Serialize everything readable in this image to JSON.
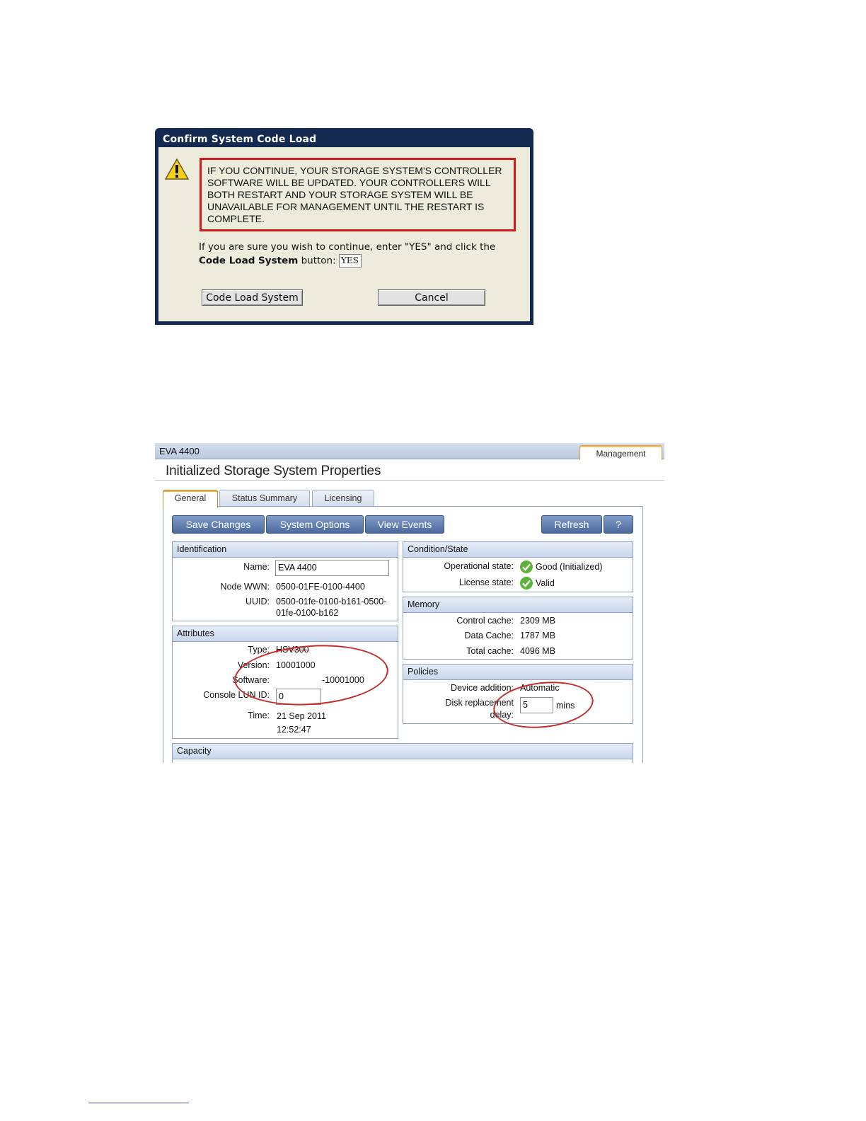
{
  "dialog": {
    "title": "Confirm System Code Load",
    "warning_text": "IF YOU CONTINUE, YOUR STORAGE SYSTEM'S CONTROLLER SOFTWARE WILL BE UPDATED. YOUR CONTROLLERS WILL BOTH RESTART AND YOUR STORAGE SYSTEM WILL BE UNAVAILABLE FOR MANAGEMENT UNTIL THE RESTART IS COMPLETE.",
    "instruction_prefix": "If you are sure you wish to continue, enter \"YES\" and click the ",
    "instruction_bold": "Code Load System",
    "instruction_suffix": " button:",
    "input_value": "YES",
    "code_load_label": "Code Load System",
    "cancel_label": "Cancel",
    "warning_icon": "warning-icon"
  },
  "props": {
    "system_name": "EVA 4400",
    "management_tab": "Management",
    "page_title": "Initialized Storage System Properties",
    "tabs": [
      {
        "label": "General",
        "active": true
      },
      {
        "label": "Status Summary",
        "active": false
      },
      {
        "label": "Licensing",
        "active": false
      }
    ],
    "toolbar": {
      "save": "Save Changes",
      "system_options": "System Options",
      "view_events": "View Events",
      "refresh": "Refresh",
      "help": "?"
    },
    "identification": {
      "header": "Identification",
      "name_label": "Name:",
      "name_value": "EVA 4400",
      "wwn_label": "Node WWN:",
      "wwn_value": "0500-01FE-0100-4400",
      "uuid_label": "UUID:",
      "uuid_line1": "0500-01fe-0100-b161-0500-",
      "uuid_line2": "01fe-0100-b162"
    },
    "attributes": {
      "header": "Attributes",
      "type_label": "Type:",
      "type_value": "HSV300",
      "version_label": "Version:",
      "version_value": "10001000",
      "software_label": "Software:",
      "software_value": "-10001000",
      "console_label": "Console LUN ID:",
      "console_value": "0",
      "time_label": "Time:",
      "time_line1": "21 Sep 2011",
      "time_line2": "12:52:47"
    },
    "condition": {
      "header": "Condition/State",
      "op_label": "Operational state:",
      "op_value": "Good (Initialized)",
      "lic_label": "License state:",
      "lic_value": "Valid"
    },
    "memory": {
      "header": "Memory",
      "control_label": "Control cache:",
      "control_value": "2309 MB",
      "data_label": "Data Cache:",
      "data_value": "1787 MB",
      "total_label": "Total cache:",
      "total_value": "4096 MB"
    },
    "policies": {
      "header": "Policies",
      "device_label": "Device addition:",
      "device_value": "Automatic",
      "disk_label_line1": "Disk replacement",
      "disk_label_line2": "delay:",
      "disk_value": "5",
      "disk_unit": "mins"
    },
    "capacity": {
      "header": "Capacity"
    },
    "colors": {
      "annotation_ellipse": "#c42a2a",
      "warning_border": "#d11c1c",
      "dialog_titlebar": "#13294f",
      "toolbar_button": "#5f7db0"
    }
  }
}
